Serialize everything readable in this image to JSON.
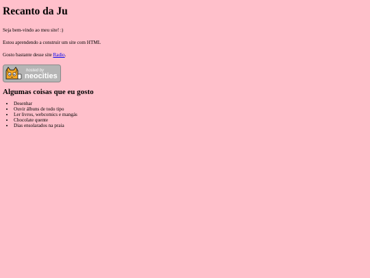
{
  "page": {
    "title": "Recanto da Ju",
    "welcome": "Seja bem-vindo ao meu site! :)",
    "learning": "Estou aprendendo a construir um site com HTML",
    "likes_prefix": "Gosto bastante desse site ",
    "likes_link": "Radio",
    "likes_suffix": "."
  },
  "badge": {
    "line1": "hosted by",
    "line2": "neocities"
  },
  "section": {
    "heading": "Algumas coisas que eu gosto",
    "items": [
      "Desenhar",
      "Ouvir álbuns de todo tipo",
      "Ler livros, webcomics e mangás",
      "Chocolate quente",
      "Dias ensolarados na praia"
    ]
  },
  "colors": {
    "background": "#ffc0cb",
    "link": "#0000ee",
    "badge_bg": "#b5b5b5",
    "cat_orange": "#f5a623"
  }
}
